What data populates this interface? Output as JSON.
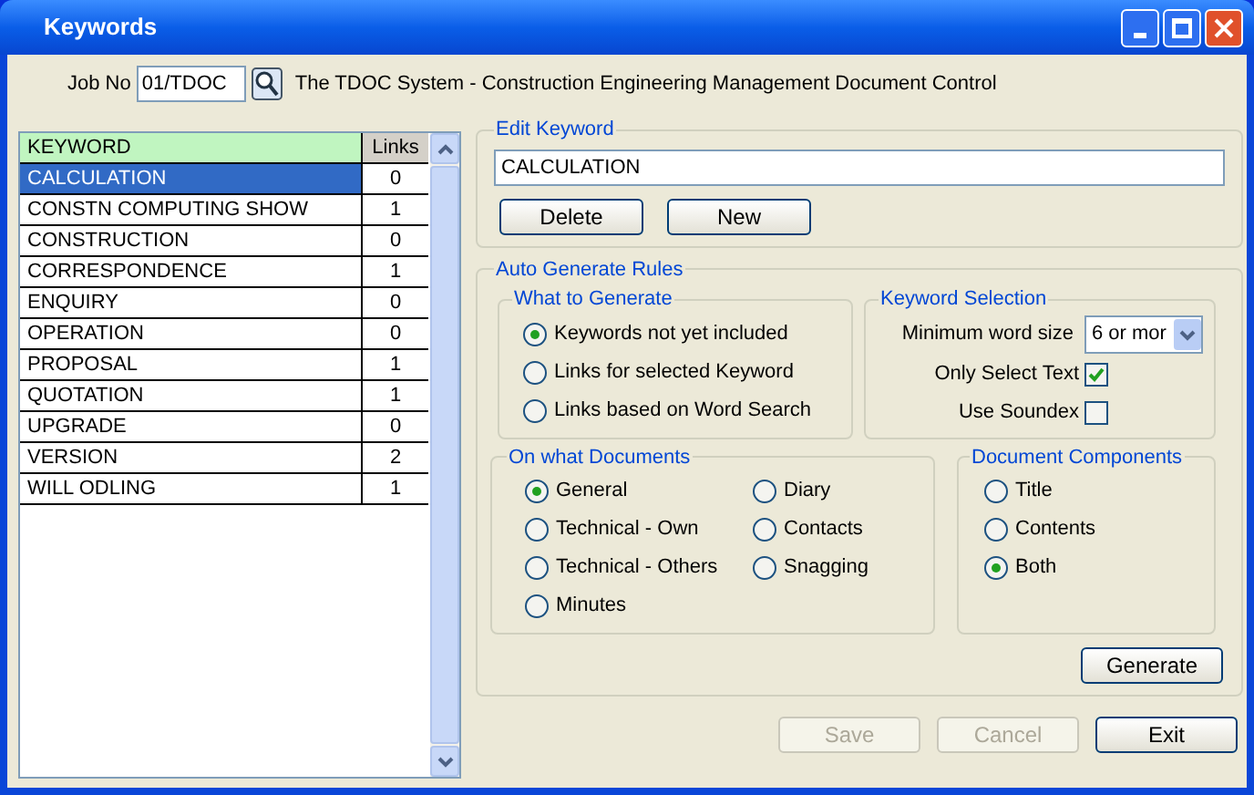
{
  "window": {
    "title": "Keywords"
  },
  "job": {
    "label": "Job No",
    "value": "01/TDOC",
    "description": "The TDOC System - Construction Engineering Management Document Control"
  },
  "keyword_table": {
    "columns": [
      "KEYWORD",
      "Links"
    ],
    "rows": [
      {
        "keyword": "CALCULATION",
        "links": "0",
        "selected": true
      },
      {
        "keyword": "CONSTN COMPUTING SHOW",
        "links": "1",
        "selected": false
      },
      {
        "keyword": "CONSTRUCTION",
        "links": "0",
        "selected": false
      },
      {
        "keyword": "CORRESPONDENCE",
        "links": "1",
        "selected": false
      },
      {
        "keyword": "ENQUIRY",
        "links": "0",
        "selected": false
      },
      {
        "keyword": "OPERATION",
        "links": "0",
        "selected": false
      },
      {
        "keyword": "PROPOSAL",
        "links": "1",
        "selected": false
      },
      {
        "keyword": "QUOTATION",
        "links": "1",
        "selected": false
      },
      {
        "keyword": "UPGRADE",
        "links": "0",
        "selected": false
      },
      {
        "keyword": "VERSION",
        "links": "2",
        "selected": false
      },
      {
        "keyword": "WILL ODLING",
        "links": "1",
        "selected": false
      }
    ]
  },
  "edit_keyword": {
    "title": "Edit Keyword",
    "value": "CALCULATION",
    "buttons": [
      "Delete",
      "New"
    ]
  },
  "auto_generate": {
    "title": "Auto Generate Rules",
    "what_to_generate": {
      "title": "What to Generate",
      "options": [
        {
          "label": "Keywords not yet included",
          "selected": true
        },
        {
          "label": "Links for selected Keyword",
          "selected": false
        },
        {
          "label": "Links based on Word Search",
          "selected": false
        }
      ]
    },
    "keyword_selection": {
      "title": "Keyword Selection",
      "min_word_size": {
        "label": "Minimum word size",
        "value": "6 or mor"
      },
      "checkboxes": [
        {
          "label": "Only Select Text",
          "checked": true
        },
        {
          "label": "Use Soundex",
          "checked": false
        }
      ]
    },
    "documents": {
      "title": "On what Documents",
      "options": [
        {
          "label": "General",
          "selected": true
        },
        {
          "label": "Technical - Own",
          "selected": false
        },
        {
          "label": "Technical - Others",
          "selected": false
        },
        {
          "label": "Minutes",
          "selected": false
        },
        {
          "label": "Diary",
          "selected": false
        },
        {
          "label": "Contacts",
          "selected": false
        },
        {
          "label": "Snagging",
          "selected": false
        }
      ]
    },
    "components": {
      "title": "Document Components",
      "options": [
        {
          "label": "Title",
          "selected": false
        },
        {
          "label": "Contents",
          "selected": false
        },
        {
          "label": "Both",
          "selected": true
        }
      ]
    },
    "generate_button": "Generate"
  },
  "buttons": [
    {
      "label": "Save",
      "disabled": true
    },
    {
      "label": "Cancel",
      "disabled": true
    },
    {
      "label": "Exit",
      "disabled": false
    }
  ]
}
